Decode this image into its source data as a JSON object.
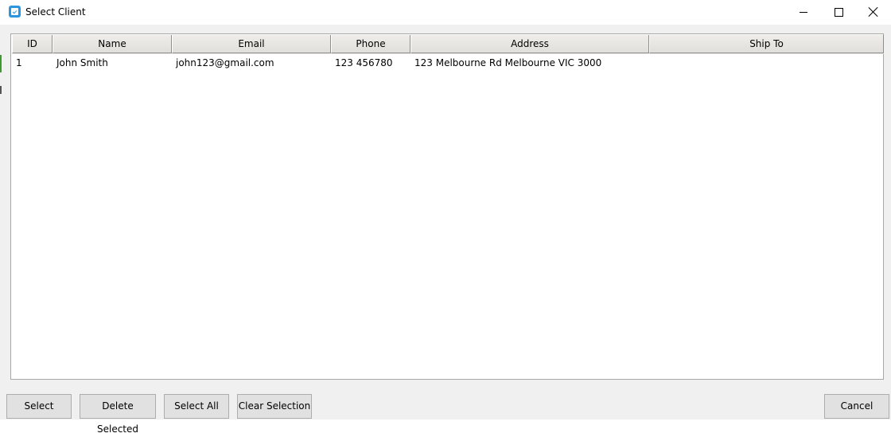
{
  "window": {
    "title": "Select Client"
  },
  "table": {
    "columns": [
      "ID",
      "Name",
      "Email",
      "Phone",
      "Address",
      "Ship To"
    ],
    "rows": [
      {
        "id": "1",
        "name": "John Smith",
        "email": "john123@gmail.com",
        "phone": "123 456780",
        "address": "123 Melbourne Rd Melbourne VIC 3000",
        "ship_to": ""
      }
    ]
  },
  "buttons": {
    "select": "Select",
    "delete_selected": "Delete Selected",
    "select_all": "Select All",
    "clear_selection": "Clear Selection",
    "cancel": "Cancel"
  },
  "icons": {
    "app": "app-icon",
    "minimize": "minimize-icon",
    "maximize": "maximize-icon",
    "close": "close-icon"
  },
  "colors": {
    "accent": "#2b96e0"
  }
}
